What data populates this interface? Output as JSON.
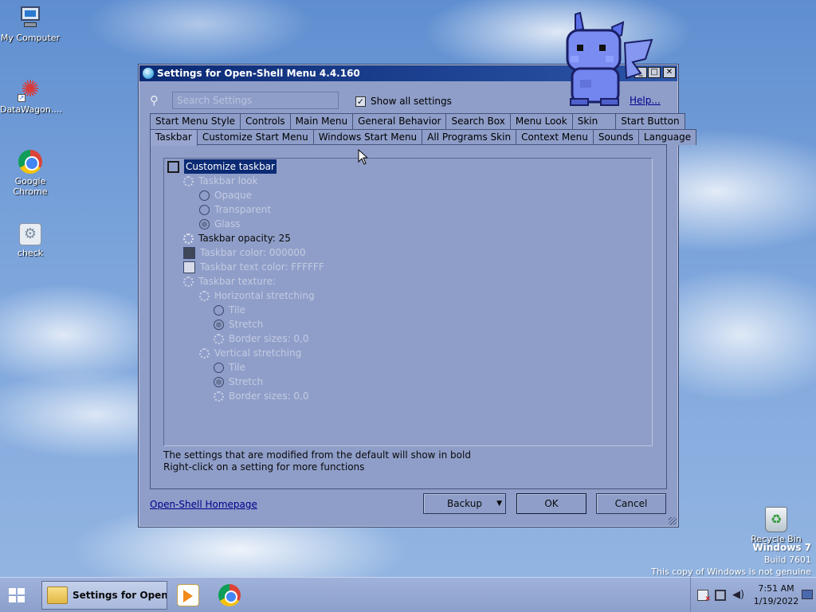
{
  "desktop": {
    "icons": [
      {
        "label": "My Computer",
        "icon": "computer-icon"
      },
      {
        "label": "DataWagon....",
        "icon": "flower-icon"
      },
      {
        "label": "Google Chrome",
        "icon": "chrome-icon"
      },
      {
        "label": "check",
        "icon": "gear-icon"
      },
      {
        "label": "Recycle Bin",
        "icon": "recycle-bin-icon"
      }
    ],
    "watermark": {
      "os": "Windows 7",
      "build": "Build 7601",
      "notice": "This copy of Windows is not genuine"
    }
  },
  "window": {
    "title": "Settings for Open-Shell Menu 4.4.160",
    "buttons": {
      "minimize": "_",
      "maximize": "□",
      "close": "✕"
    },
    "search_placeholder": "Search Settings",
    "show_all_label": "Show all settings",
    "show_all_checked": true,
    "help_label": "Help...",
    "tabs_row1": [
      "Start Menu Style",
      "Controls",
      "Main Menu",
      "General Behavior",
      "Search Box",
      "Menu Look",
      "Skin",
      "Start Button"
    ],
    "tabs_row2": [
      "Taskbar",
      "Customize Start Menu",
      "Windows Start Menu",
      "All Programs Skin",
      "Context Menu",
      "Sounds",
      "Language"
    ],
    "active_tab": "Taskbar",
    "tree": {
      "customize_taskbar": "Customize taskbar",
      "taskbar_look": "Taskbar look",
      "opaque": "Opaque",
      "transparent": "Transparent",
      "glass": "Glass",
      "opacity": "Taskbar opacity: 25",
      "color": "Taskbar color: 000000",
      "text_color": "Taskbar text color: FFFFFF",
      "texture": "Taskbar texture:",
      "horizontal": "Horizontal stretching",
      "h_tile": "Tile",
      "h_stretch": "Stretch",
      "h_border": "Border sizes: 0,0",
      "vertical": "Vertical stretching",
      "v_tile": "Tile",
      "v_stretch": "Stretch",
      "v_border": "Border sizes: 0,0"
    },
    "swatches": {
      "taskbar_color": "#000000",
      "taskbar_text_color": "#FFFFFF"
    },
    "notes": [
      "The settings that are modified from the default will show in bold",
      "Right-click on a setting for more functions"
    ],
    "homepage_label": "Open-Shell Homepage",
    "backup_label": "Backup",
    "ok_label": "OK",
    "cancel_label": "Cancel"
  },
  "taskbar": {
    "task_label": "Settings for Open-...",
    "clock_time": "7:51 AM",
    "clock_date": "1/19/2022"
  },
  "colors": {
    "title_bar": "#0b2a74",
    "dialog_bg": "#8f9ec9",
    "link": "#00008b"
  }
}
